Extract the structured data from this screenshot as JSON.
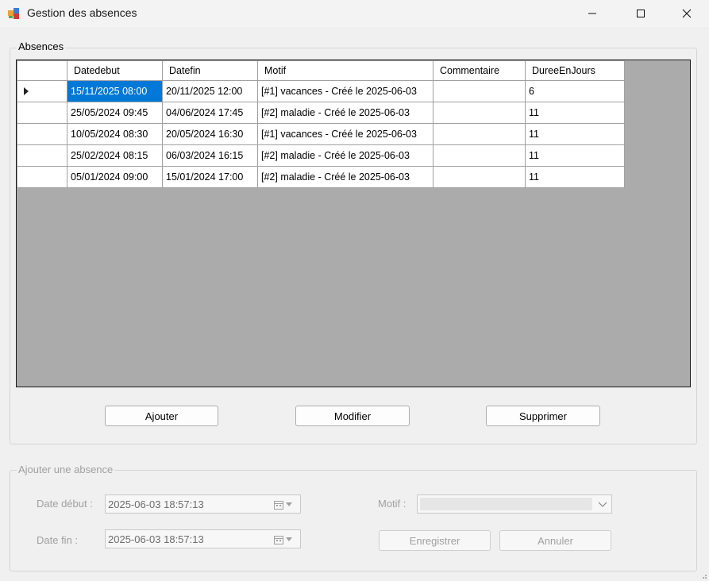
{
  "window": {
    "title": "Gestion des absences",
    "icons": {
      "app": "app-icon",
      "minimize": "minimize-icon",
      "maximize": "maximize-icon",
      "close": "close-icon"
    }
  },
  "absences_group": {
    "legend": "Absences",
    "grid": {
      "columns": [
        "Datedebut",
        "Datefin",
        "Motif",
        "Commentaire",
        "DureeEnJours"
      ],
      "rows": [
        {
          "datedebut": "15/11/2025 08:00",
          "datefin": "20/11/2025 12:00",
          "motif": "[#1] vacances - Créé le 2025-06-03",
          "commentaire": "",
          "duree": "6"
        },
        {
          "datedebut": "25/05/2024 09:45",
          "datefin": "04/06/2024 17:45",
          "motif": "[#2] maladie - Créé le 2025-06-03",
          "commentaire": "",
          "duree": "11"
        },
        {
          "datedebut": "10/05/2024 08:30",
          "datefin": "20/05/2024 16:30",
          "motif": "[#1] vacances - Créé le 2025-06-03",
          "commentaire": "",
          "duree": "11"
        },
        {
          "datedebut": "25/02/2024 08:15",
          "datefin": "06/03/2024 16:15",
          "motif": "[#2] maladie - Créé le 2025-06-03",
          "commentaire": "",
          "duree": "11"
        },
        {
          "datedebut": "05/01/2024 09:00",
          "datefin": "15/01/2024 17:00",
          "motif": "[#2] maladie - Créé le 2025-06-03",
          "commentaire": "",
          "duree": "11"
        }
      ]
    },
    "buttons": {
      "ajouter": "Ajouter",
      "modifier": "Modifier",
      "supprimer": "Supprimer"
    }
  },
  "form_group": {
    "legend": "Ajouter une absence",
    "date_debut_label": "Date début :",
    "date_debut_value": "2025-06-03  18:57:13",
    "date_fin_label": "Date fin :",
    "date_fin_value": "2025-06-03  18:57:13",
    "motif_label": "Motif :",
    "motif_value": "",
    "enregistrer": "Enregistrer",
    "annuler": "Annuler"
  }
}
